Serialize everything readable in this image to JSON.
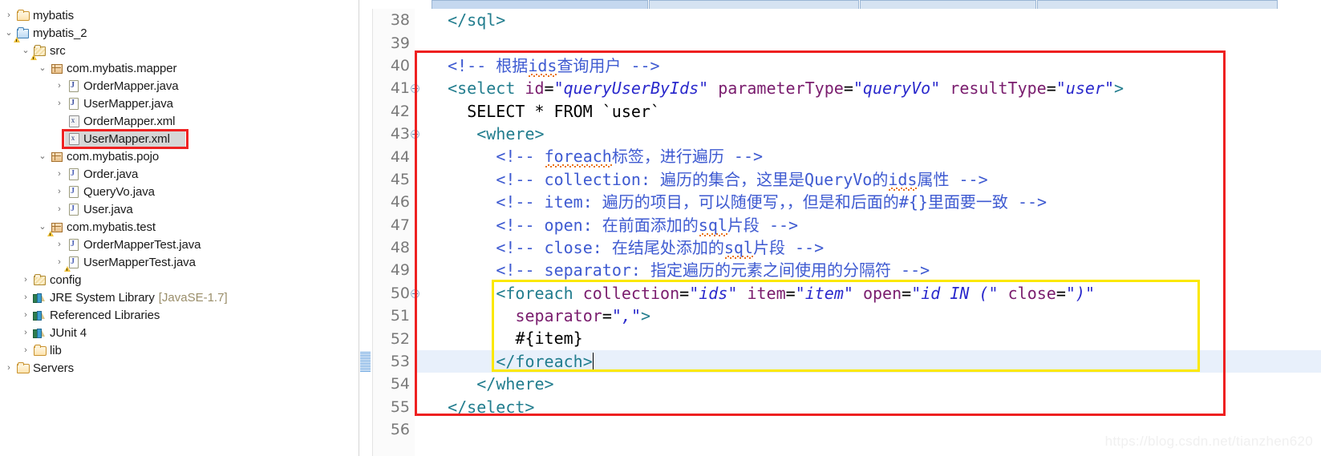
{
  "explorer": {
    "name": "package-explorer",
    "items": [
      {
        "label": "mybatis",
        "icon": "folder-icon",
        "twisty": "collapsed",
        "indent": 0,
        "suffix": "",
        "warn": false,
        "selected": false,
        "highlight": false
      },
      {
        "label": "mybatis_2",
        "icon": "project-icon",
        "twisty": "expanded",
        "indent": 0,
        "suffix": "",
        "warn": true,
        "selected": false,
        "highlight": false
      },
      {
        "label": "src",
        "icon": "source-folder-icon",
        "twisty": "expanded",
        "indent": 1,
        "suffix": "",
        "warn": true,
        "selected": false,
        "highlight": false
      },
      {
        "label": "com.mybatis.mapper",
        "icon": "package-icon",
        "twisty": "expanded",
        "indent": 2,
        "suffix": "",
        "warn": false,
        "selected": false,
        "highlight": false
      },
      {
        "label": "OrderMapper.java",
        "icon": "java-interface-icon",
        "twisty": "collapsed",
        "indent": 3,
        "suffix": "",
        "warn": false,
        "selected": false,
        "highlight": false
      },
      {
        "label": "UserMapper.java",
        "icon": "java-interface-icon",
        "twisty": "collapsed",
        "indent": 3,
        "suffix": "",
        "warn": false,
        "selected": false,
        "highlight": false
      },
      {
        "label": "OrderMapper.xml",
        "icon": "xml-file-icon",
        "twisty": "none",
        "indent": 3,
        "suffix": "",
        "warn": false,
        "selected": false,
        "highlight": false
      },
      {
        "label": "UserMapper.xml",
        "icon": "xml-file-icon",
        "twisty": "none",
        "indent": 3,
        "suffix": "",
        "warn": false,
        "selected": true,
        "highlight": true
      },
      {
        "label": "com.mybatis.pojo",
        "icon": "package-icon",
        "twisty": "expanded",
        "indent": 2,
        "suffix": "",
        "warn": false,
        "selected": false,
        "highlight": false
      },
      {
        "label": "Order.java",
        "icon": "java-class-icon",
        "twisty": "collapsed",
        "indent": 3,
        "suffix": "",
        "warn": false,
        "selected": false,
        "highlight": false
      },
      {
        "label": "QueryVo.java",
        "icon": "java-class-icon",
        "twisty": "collapsed",
        "indent": 3,
        "suffix": "",
        "warn": false,
        "selected": false,
        "highlight": false
      },
      {
        "label": "User.java",
        "icon": "java-class-icon",
        "twisty": "collapsed",
        "indent": 3,
        "suffix": "",
        "warn": false,
        "selected": false,
        "highlight": false
      },
      {
        "label": "com.mybatis.test",
        "icon": "package-icon",
        "twisty": "expanded",
        "indent": 2,
        "suffix": "",
        "warn": true,
        "selected": false,
        "highlight": false
      },
      {
        "label": "OrderMapperTest.java",
        "icon": "java-class-icon",
        "twisty": "collapsed",
        "indent": 3,
        "suffix": "",
        "warn": false,
        "selected": false,
        "highlight": false
      },
      {
        "label": "UserMapperTest.java",
        "icon": "java-class-icon",
        "twisty": "collapsed",
        "indent": 3,
        "suffix": "",
        "warn": true,
        "selected": false,
        "highlight": false
      },
      {
        "label": "config",
        "icon": "source-folder-icon",
        "twisty": "collapsed",
        "indent": 1,
        "suffix": "",
        "warn": false,
        "selected": false,
        "highlight": false
      },
      {
        "label": "JRE System Library",
        "icon": "library-icon",
        "twisty": "collapsed",
        "indent": 1,
        "suffix": "[JavaSE-1.7]",
        "warn": false,
        "selected": false,
        "highlight": false
      },
      {
        "label": "Referenced Libraries",
        "icon": "library-icon",
        "twisty": "collapsed",
        "indent": 1,
        "suffix": "",
        "warn": false,
        "selected": false,
        "highlight": false
      },
      {
        "label": "JUnit 4",
        "icon": "library-icon",
        "twisty": "collapsed",
        "indent": 1,
        "suffix": "",
        "warn": false,
        "selected": false,
        "highlight": false
      },
      {
        "label": "lib",
        "icon": "folder-icon",
        "twisty": "collapsed",
        "indent": 1,
        "suffix": "",
        "warn": false,
        "selected": false,
        "highlight": false
      },
      {
        "label": "Servers",
        "icon": "folder-icon",
        "twisty": "collapsed",
        "indent": 0,
        "suffix": "",
        "warn": false,
        "selected": false,
        "highlight": false
      }
    ]
  },
  "editor": {
    "name": "xml-code-editor",
    "watermark": "https://blog.csdn.net/tianzhen620",
    "current_line": 53,
    "lines": [
      {
        "num": 38,
        "fold": false,
        "indent": 2,
        "tokens": [
          {
            "t": "tag",
            "s": "</sql>"
          }
        ]
      },
      {
        "num": 39,
        "fold": false,
        "indent": 0,
        "tokens": []
      },
      {
        "num": 40,
        "fold": false,
        "indent": 2,
        "tokens": [
          {
            "t": "comment",
            "s": "<!-- 根据"
          },
          {
            "t": "comment-squig",
            "s": "ids"
          },
          {
            "t": "comment",
            "s": "查询用户 -->"
          }
        ]
      },
      {
        "num": 41,
        "fold": true,
        "indent": 2,
        "tokens": [
          {
            "t": "tag",
            "s": "<select "
          },
          {
            "t": "attr",
            "s": "id"
          },
          {
            "t": "plain",
            "s": "="
          },
          {
            "t": "val",
            "s": "\"queryUserByIds\""
          },
          {
            "t": "plain",
            "s": " "
          },
          {
            "t": "attr",
            "s": "parameterType"
          },
          {
            "t": "plain",
            "s": "="
          },
          {
            "t": "val",
            "s": "\"queryVo\""
          },
          {
            "t": "plain",
            "s": " "
          },
          {
            "t": "attr",
            "s": "resultType"
          },
          {
            "t": "plain",
            "s": "="
          },
          {
            "t": "val",
            "s": "\"user\""
          },
          {
            "t": "tag",
            "s": ">"
          }
        ]
      },
      {
        "num": 42,
        "fold": false,
        "indent": 4,
        "tokens": [
          {
            "t": "plain",
            "s": "SELECT * FROM `user`"
          }
        ]
      },
      {
        "num": 43,
        "fold": true,
        "indent": 5,
        "tokens": [
          {
            "t": "tag",
            "s": "<where>"
          }
        ]
      },
      {
        "num": 44,
        "fold": false,
        "indent": 7,
        "tokens": [
          {
            "t": "comment",
            "s": "<!-- "
          },
          {
            "t": "comment-squig",
            "s": "foreach"
          },
          {
            "t": "comment",
            "s": "标签，进行遍历 -->"
          }
        ]
      },
      {
        "num": 45,
        "fold": false,
        "indent": 7,
        "tokens": [
          {
            "t": "comment",
            "s": "<!-- collection: 遍历的集合，这里是QueryVo的"
          },
          {
            "t": "comment-squig",
            "s": "ids"
          },
          {
            "t": "comment",
            "s": "属性 -->"
          }
        ]
      },
      {
        "num": 46,
        "fold": false,
        "indent": 7,
        "tokens": [
          {
            "t": "comment",
            "s": "<!-- item: 遍历的项目，可以随便写，，但是和后面的#{}里面要一致 -->"
          }
        ]
      },
      {
        "num": 47,
        "fold": false,
        "indent": 7,
        "tokens": [
          {
            "t": "comment",
            "s": "<!-- open: 在前面添加的"
          },
          {
            "t": "comment-squig",
            "s": "sql"
          },
          {
            "t": "comment",
            "s": "片段 -->"
          }
        ]
      },
      {
        "num": 48,
        "fold": false,
        "indent": 7,
        "tokens": [
          {
            "t": "comment",
            "s": "<!-- close: 在结尾处添加的"
          },
          {
            "t": "comment-squig",
            "s": "sql"
          },
          {
            "t": "comment",
            "s": "片段 -->"
          }
        ]
      },
      {
        "num": 49,
        "fold": false,
        "indent": 7,
        "tokens": [
          {
            "t": "comment",
            "s": "<!-- separator: 指定遍历的元素之间使用的分隔符 -->"
          }
        ]
      },
      {
        "num": 50,
        "fold": true,
        "indent": 7,
        "tokens": [
          {
            "t": "tag",
            "s": "<foreach "
          },
          {
            "t": "attr",
            "s": "collection"
          },
          {
            "t": "plain",
            "s": "="
          },
          {
            "t": "val",
            "s": "\"ids\""
          },
          {
            "t": "plain",
            "s": " "
          },
          {
            "t": "attr",
            "s": "item"
          },
          {
            "t": "plain",
            "s": "="
          },
          {
            "t": "val",
            "s": "\"item\""
          },
          {
            "t": "plain",
            "s": " "
          },
          {
            "t": "attr",
            "s": "open"
          },
          {
            "t": "plain",
            "s": "="
          },
          {
            "t": "val",
            "s": "\"id IN (\""
          },
          {
            "t": "plain",
            "s": " "
          },
          {
            "t": "attr",
            "s": "close"
          },
          {
            "t": "plain",
            "s": "="
          },
          {
            "t": "val",
            "s": "\")\""
          }
        ]
      },
      {
        "num": 51,
        "fold": false,
        "indent": 9,
        "tokens": [
          {
            "t": "attr",
            "s": "separator"
          },
          {
            "t": "plain",
            "s": "="
          },
          {
            "t": "val",
            "s": "\",\""
          },
          {
            "t": "tag",
            "s": ">"
          }
        ]
      },
      {
        "num": 52,
        "fold": false,
        "indent": 9,
        "tokens": [
          {
            "t": "plain",
            "s": "#{item}"
          }
        ]
      },
      {
        "num": 53,
        "fold": false,
        "indent": 7,
        "tokens": [
          {
            "t": "tag",
            "s": "</foreach>"
          },
          {
            "t": "caret",
            "s": ""
          }
        ]
      },
      {
        "num": 54,
        "fold": false,
        "indent": 5,
        "tokens": [
          {
            "t": "tag",
            "s": "</where>"
          }
        ]
      },
      {
        "num": 55,
        "fold": false,
        "indent": 2,
        "tokens": [
          {
            "t": "tag",
            "s": "</select>"
          }
        ]
      },
      {
        "num": 56,
        "fold": false,
        "indent": 0,
        "tokens": []
      }
    ]
  },
  "colors": {
    "tag": "#227d8e",
    "attribute": "#7a1d6e",
    "value": "#2a29cc",
    "comment": "#3e5ad1",
    "plain": "#000000",
    "annotation_red": "#ee2020",
    "annotation_yellow": "#fbe800",
    "current_line_bg": "#e8f0fb",
    "selection_bg": "#d6d6d6"
  }
}
